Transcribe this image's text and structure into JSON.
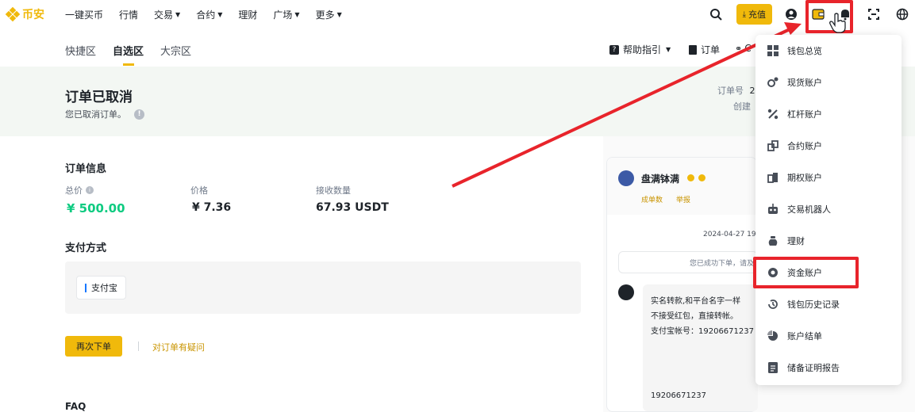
{
  "topnav": {
    "logo_text": "币安",
    "items": [
      {
        "label": "一键买币",
        "chevron": false
      },
      {
        "label": "行情",
        "chevron": false
      },
      {
        "label": "交易",
        "chevron": true
      },
      {
        "label": "合约",
        "chevron": true
      },
      {
        "label": "理财",
        "chevron": false
      },
      {
        "label": "广场",
        "chevron": true
      },
      {
        "label": "更多",
        "chevron": true
      }
    ],
    "deposit_label": "充值"
  },
  "subnav": {
    "tabs": [
      "快捷区",
      "自选区",
      "大宗区"
    ],
    "active_tab": "自选区",
    "help_label": "帮助指引",
    "orders_label": "订单",
    "partial_label": "C"
  },
  "order_status": {
    "title": "订单已取消",
    "subtitle": "您已取消订单。",
    "order_no_label": "订单号",
    "order_no_partial": "2",
    "created_label_partial": "创建"
  },
  "order_info": {
    "heading": "订单信息",
    "total_label": "总价",
    "total_value": "¥ 500.00",
    "price_label": "价格",
    "price_value": "¥ 7.36",
    "qty_label": "接收数量",
    "qty_value": "67.93 USDT"
  },
  "payment": {
    "heading": "支付方式",
    "method": "支付宝"
  },
  "actions": {
    "reorder_label": "再次下单",
    "question_label": "对订单有疑问"
  },
  "faq_label": "FAQ",
  "chat": {
    "merchant_name": "盘满钵满",
    "stat1": "成单数",
    "stat2": "举报",
    "timestamp": "2024-04-27 19",
    "system_msg": "您已成功下单，请及",
    "msg_line1": "实名转款,和平台名字一样",
    "msg_line2": "不接受红包，直接转帐。",
    "msg_line3": "支付宝帐号：19206671237",
    "msg_number": "19206671237"
  },
  "wallet_menu": {
    "items": [
      {
        "label": "钱包总览",
        "icon": "grid-icon"
      },
      {
        "label": "现货账户",
        "icon": "spot-icon"
      },
      {
        "label": "杠杆账户",
        "icon": "percent-icon"
      },
      {
        "label": "合约账户",
        "icon": "futures-icon"
      },
      {
        "label": "期权账户",
        "icon": "options-icon"
      },
      {
        "label": "交易机器人",
        "icon": "robot-icon"
      },
      {
        "label": "理财",
        "icon": "earn-icon"
      },
      {
        "label": "资金账户",
        "icon": "funding-icon"
      },
      {
        "label": "钱包历史记录",
        "icon": "history-icon"
      },
      {
        "label": "账户结单",
        "icon": "pie-icon"
      },
      {
        "label": "储备证明报告",
        "icon": "document-icon"
      }
    ],
    "highlighted": "资金账户"
  },
  "colors": {
    "brand_yellow": "#f0b90b",
    "highlight_red": "#e8242b",
    "price_green": "#0ecb81",
    "band_green": "#f3f7f3"
  }
}
